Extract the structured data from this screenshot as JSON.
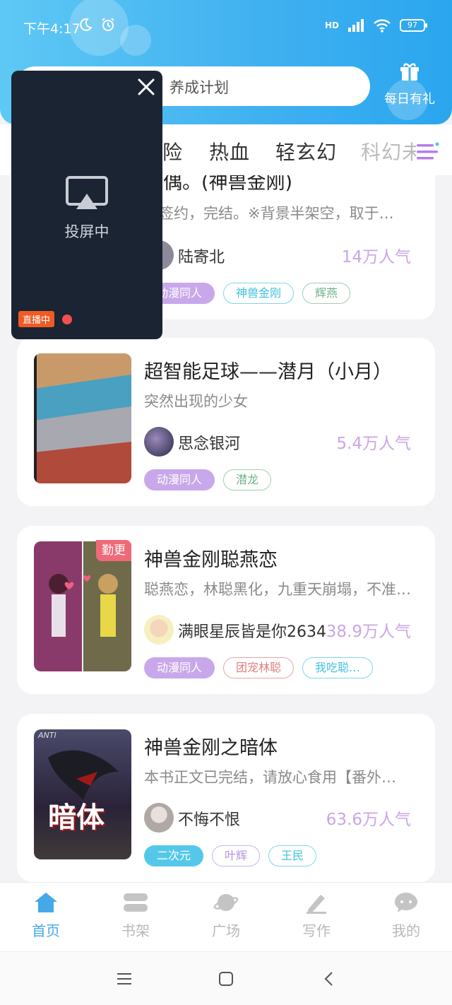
{
  "status": {
    "time": "下午4:17",
    "battery": "97",
    "signal": "HD"
  },
  "header": {
    "search_text": "养成计划",
    "gift_label": "每日有礼"
  },
  "tabs": [
    "险",
    "热血",
    "轻玄幻",
    "科幻未"
  ],
  "cast": {
    "label": "投屏中",
    "live": "直播中"
  },
  "books": [
    {
      "title": "宠偶。(神兽金刚)",
      "desc": "已签约，完结。※背景半架空，取于…",
      "author": "陆寄北",
      "popularity": "14万人气",
      "tags": [
        "动漫同人",
        "神兽金刚",
        "辉燕"
      ]
    },
    {
      "title": "超智能足球——潜月（小月）",
      "desc": "突然出现的少女",
      "author": "思念银河",
      "popularity": "5.4万人气",
      "tags": [
        "动漫同人",
        "潜龙"
      ]
    },
    {
      "title": "神兽金刚聪燕恋",
      "desc": "聪燕恋，林聪黑化，九重天崩塌，不准…",
      "author": "满眼星辰皆是你2634",
      "popularity": "38.9万人气",
      "tags": [
        "动漫同人",
        "团宠林聪",
        "我吃聪…"
      ],
      "badge": "勤更"
    },
    {
      "title": "神兽金刚之暗体",
      "desc": "本书正文已完结，请放心食用【番外…",
      "author": "不悔不恨",
      "popularity": "63.6万人气",
      "tags": [
        "二次元",
        "叶辉",
        "王民"
      ],
      "cover_text": "暗体",
      "cover_small": "ANTI"
    }
  ],
  "nav": [
    "首页",
    "书架",
    "广场",
    "写作",
    "我的"
  ],
  "colors": {
    "accent": "#45a8e8",
    "header": "#3fb0f0",
    "popularity": "#c9a6e8"
  }
}
